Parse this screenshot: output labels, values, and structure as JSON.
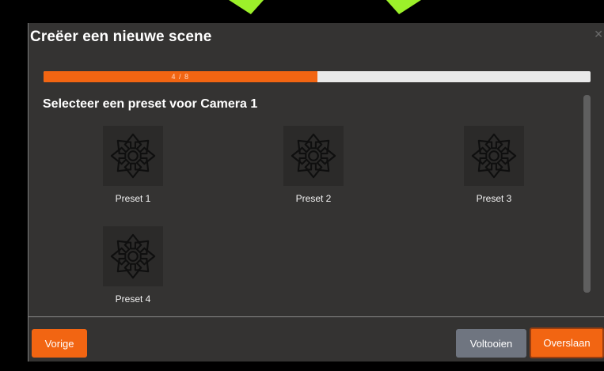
{
  "dialog": {
    "title": "Creëer een nieuwe scene",
    "close_icon": "close-icon",
    "progress": {
      "text": "4 / 8",
      "current": 4,
      "total": 8
    },
    "subtitle": "Selecteer een preset voor Camera 1",
    "presets": [
      {
        "label": "Preset 1",
        "icon": "pan-tilt-arrows-icon"
      },
      {
        "label": "Preset 2",
        "icon": "pan-tilt-arrows-icon"
      },
      {
        "label": "Preset 3",
        "icon": "pan-tilt-arrows-icon"
      },
      {
        "label": "Preset 4",
        "icon": "pan-tilt-arrows-icon"
      }
    ],
    "buttons": {
      "prev": "Vorige",
      "finish": "Voltooien",
      "skip": "Overslaan"
    }
  },
  "colors": {
    "accent": "#f26512",
    "dialog_bg": "#343332",
    "finish_button": "#6f7580",
    "annotation_arrow": "#9cf02a"
  }
}
